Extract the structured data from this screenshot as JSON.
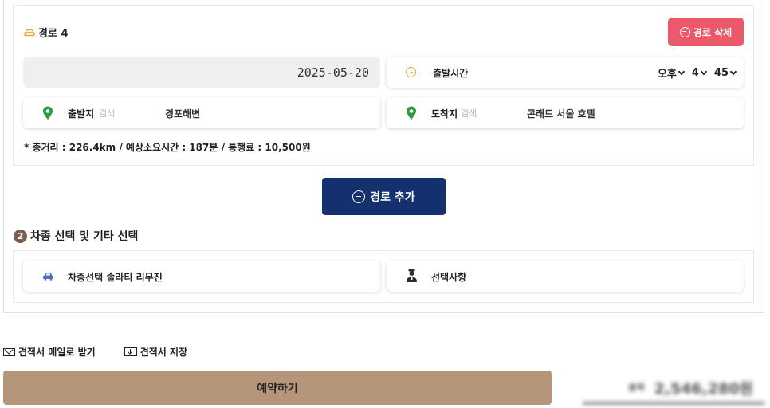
{
  "route": {
    "title": "경로 4",
    "delete_label": "경로 삭제",
    "date": "2025-05-20",
    "departure_time_label": "출발시간",
    "ampm": "오후",
    "hour": "4",
    "minute": "45",
    "start_label": "출발지",
    "start_search": "검색",
    "start_value": "경포해변",
    "end_label": "도착지",
    "end_search": "검색",
    "end_value": "콘래드 서울 호텔",
    "summary": "* 총거리 : 226.4km / 예상소요시간 : 187분 / 통행료 : 10,500원"
  },
  "add_route_label": "경로 추가",
  "section2": {
    "badge": "2",
    "title": "차종 선택 및 기타 선택",
    "vehicle_label": "차종선택 솔라티 리무진",
    "options_label": "선택사항"
  },
  "bottom": {
    "email_label": "견적서 메일로 받기",
    "save_label": "견적서 저장",
    "reserve_label": "예약하기",
    "price_label": "총액",
    "price_value": "2,546,280원"
  },
  "colors": {
    "delete": "#ec5a6a",
    "add_route": "#14306e",
    "reserve": "#b5967a",
    "pin": "#2f9a3f",
    "clock": "#e8a43c",
    "badge": "#7a5f4f"
  },
  "icons": [
    "car-icon",
    "minus-circle-icon",
    "clock-icon",
    "map-pin-icon",
    "plus-circle-icon",
    "person-icon",
    "mail-icon",
    "save-icon",
    "chevron-down-icon"
  ]
}
